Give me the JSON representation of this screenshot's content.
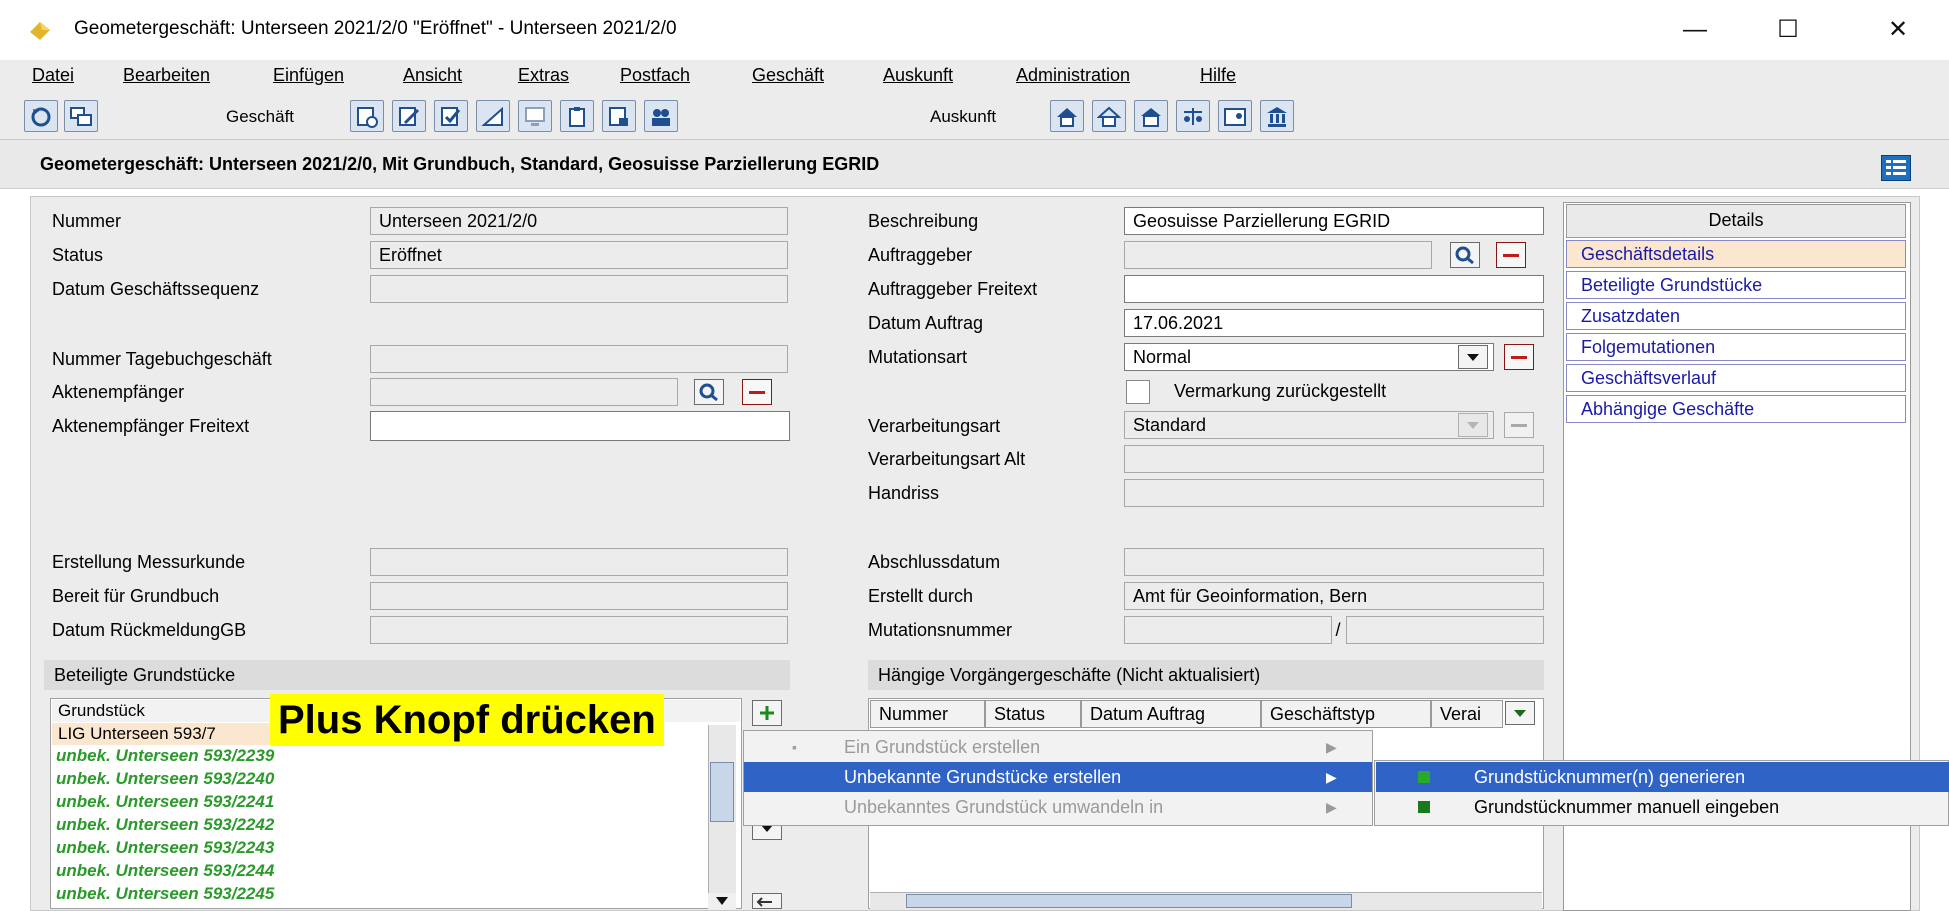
{
  "window": {
    "title": "Geometergeschäft: Unterseen 2021/2/0 \"Eröffnet\"  - Unterseen 2021/2/0",
    "minimize": "—",
    "maximize": "☐",
    "close": "✕"
  },
  "menu": [
    "Datei",
    "Bearbeiten",
    "Einfügen",
    "Ansicht",
    "Extras",
    "Postfach",
    "Geschäft",
    "Auskunft",
    "Administration",
    "Hilfe"
  ],
  "toolbar": {
    "geschaeft_label": "Geschäft",
    "auskunft_label": "Auskunft"
  },
  "header": {
    "title": "Geometergeschäft: Unterseen 2021/2/0, Mit Grundbuch, Standard, Geosuisse Parziellerung EGRID"
  },
  "form_left": {
    "nummer_label": "Nummer",
    "nummer_value": "Unterseen 2021/2/0",
    "status_label": "Status",
    "status_value": "Eröffnet",
    "datum_sequenz_label": "Datum Geschäftssequenz",
    "tagebuch_label": "Nummer Tagebuchgeschäft",
    "aktenempfaenger_label": "Aktenempfänger",
    "aktenempfaenger_freitext_label": "Aktenempfänger Freitext",
    "messurkunde_label": "Erstellung Messurkunde",
    "bereit_label": "Bereit für Grundbuch",
    "rueckmeldung_label": "Datum RückmeldungGB"
  },
  "form_right": {
    "beschreibung_label": "Beschreibung",
    "beschreibung_value": "Geosuisse Parziellerung EGRID",
    "auftraggeber_label": "Auftraggeber",
    "auftraggeber_freitext_label": "Auftraggeber Freitext",
    "datum_auftrag_label": "Datum Auftrag",
    "datum_auftrag_value": "17.06.2021",
    "mutationsart_label": "Mutationsart",
    "mutationsart_value": "Normal",
    "vermarkung_label": "Vermarkung zurückgestellt",
    "verarbeitungsart_label": "Verarbeitungsart",
    "verarbeitungsart_value": "Standard",
    "verarbeitungsart_alt_label": "Verarbeitungsart Alt",
    "handriss_label": "Handriss",
    "abschlussdatum_label": "Abschlussdatum",
    "erstellt_durch_label": "Erstellt durch",
    "erstellt_durch_value": "Amt für Geoinformation, Bern",
    "mutationsnummer_label": "Mutationsnummer",
    "mutationsnummer_sep": "/"
  },
  "details": {
    "header": "Details",
    "items": [
      "Geschäftsdetails",
      "Beteiligte Grundstücke",
      "Zusatzdaten",
      "Folgemutationen",
      "Geschäftsverlauf",
      "Abhängige Geschäfte"
    ]
  },
  "grundstuecke": {
    "section_title": "Beteiligte Grundstücke",
    "column": "Grundstück",
    "first_row": "LIG Unterseen 593/7",
    "rows": [
      "unbek. Unterseen 593/2239",
      "unbek. Unterseen 593/2240",
      "unbek. Unterseen 593/2241",
      "unbek. Unterseen 593/2242",
      "unbek. Unterseen 593/2243",
      "unbek. Unterseen 593/2244",
      "unbek. Unterseen 593/2245"
    ]
  },
  "vorgaenger": {
    "section_title": "Hängige Vorgängergeschäfte (Nicht aktualisiert)",
    "columns": [
      "Nummer",
      "Status",
      "Datum Auftrag",
      "Geschäftstyp",
      "Verai"
    ]
  },
  "context_menu": {
    "items": [
      "Ein Grundstück erstellen",
      "Unbekannte Grundstücke erstellen",
      "Unbekanntes Grundstück umwandeln in"
    ],
    "submenu": [
      "Grundstücknummer(n) generieren",
      "Grundstücknummer manuell eingeben"
    ]
  },
  "callout": "Plus Knopf drücken",
  "colors": {
    "link": "#1a1aa6",
    "highlight": "#2f64c6",
    "green": "#2a9a2a",
    "callout": "#ffff00"
  }
}
